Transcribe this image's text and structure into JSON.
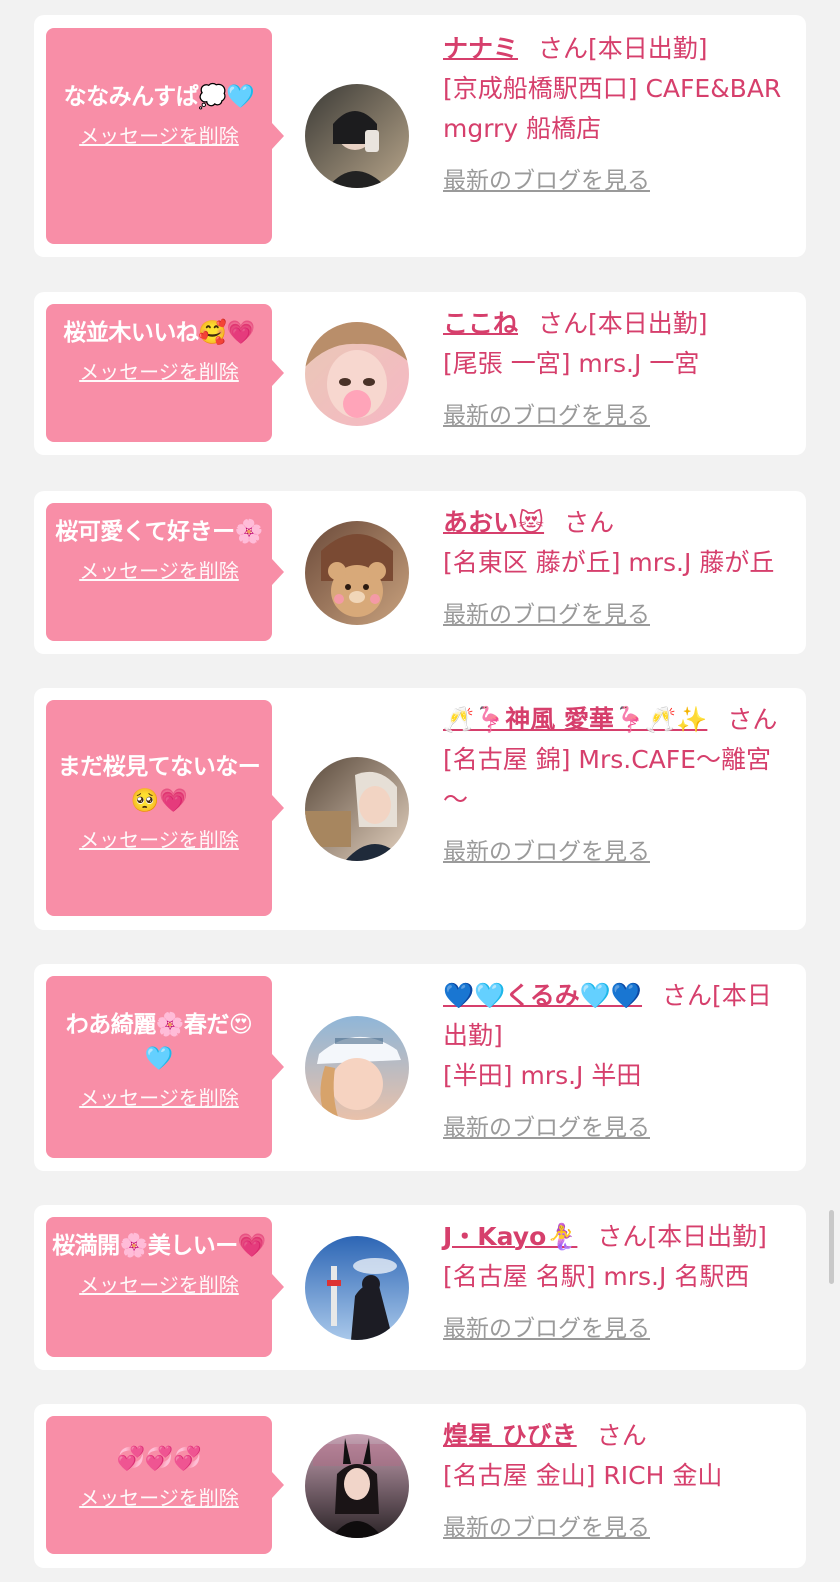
{
  "colors": {
    "bubble": "#f88ea7",
    "accent": "#d63f6c",
    "link_gray": "#9a9a9a",
    "background": "#f2f2f2"
  },
  "cards": [
    {
      "message": "ななみんすぱ💭🩵",
      "delete_label": "メッセージを削除",
      "name": "ナナミ",
      "honorific": "さん",
      "status": "[本日出勤]",
      "shop": "[京成船橋駅西口] CAFE&BAR mgrry 船橋店",
      "blog_label": "最新のブログを見る",
      "avatar_colors": [
        "#3b3a36",
        "#b7a58a"
      ]
    },
    {
      "message": "桜並木いいね🥰💗",
      "delete_label": "メッセージを削除",
      "name": "ここね",
      "honorific": "さん",
      "status": "[本日出勤]",
      "shop": "[尾張 一宮] mrs.J 一宮",
      "blog_label": "最新のブログを見る",
      "avatar_colors": [
        "#e9c9b6",
        "#f6b7c4"
      ]
    },
    {
      "message": "桜可愛くて好きー🌸",
      "delete_label": "メッセージを削除",
      "name": "あおい😻",
      "honorific": "さん",
      "status": "",
      "shop": "[名東区 藤が丘] mrs.J 藤が丘",
      "blog_label": "最新のブログを見る",
      "avatar_colors": [
        "#6b4a3a",
        "#c9a27e"
      ]
    },
    {
      "message": "まだ桜見てないなー🥺💗",
      "delete_label": "メッセージを削除",
      "name": "🥂🦩神風 愛華🦩🥂✨",
      "honorific": "さん",
      "status": "",
      "shop": "[名古屋 錦] Mrs.CAFE～離宮～",
      "blog_label": "最新のブログを見る",
      "avatar_colors": [
        "#5a4a3c",
        "#e4d2c0"
      ]
    },
    {
      "message": "わあ綺麗🌸春だ😍🩵",
      "delete_label": "メッセージを削除",
      "name": "💙🩵くるみ🩵💙",
      "honorific": "さん",
      "status": "[本日出勤]",
      "shop": "[半田] mrs.J 半田",
      "blog_label": "最新のブログを見る",
      "avatar_colors": [
        "#8fb6d8",
        "#e9c1aa"
      ]
    },
    {
      "message": "桜満開🌸美しいー💗",
      "delete_label": "メッセージを削除",
      "name": "J・Kayo🧜‍♀️",
      "honorific": "さん",
      "status": "[本日出勤]",
      "shop": "[名古屋 名駅] mrs.J 名駅西",
      "blog_label": "最新のブログを見る",
      "avatar_colors": [
        "#2d66b5",
        "#a9c8ea"
      ]
    },
    {
      "message": "💞💞💞",
      "delete_label": "メッセージを削除",
      "name": "煌星 ひびき",
      "honorific": "さん",
      "status": "",
      "shop": "[名古屋 金山] RICH 金山",
      "blog_label": "最新のブログを見る",
      "avatar_colors": [
        "#c7a2b4",
        "#2a2326"
      ]
    }
  ]
}
